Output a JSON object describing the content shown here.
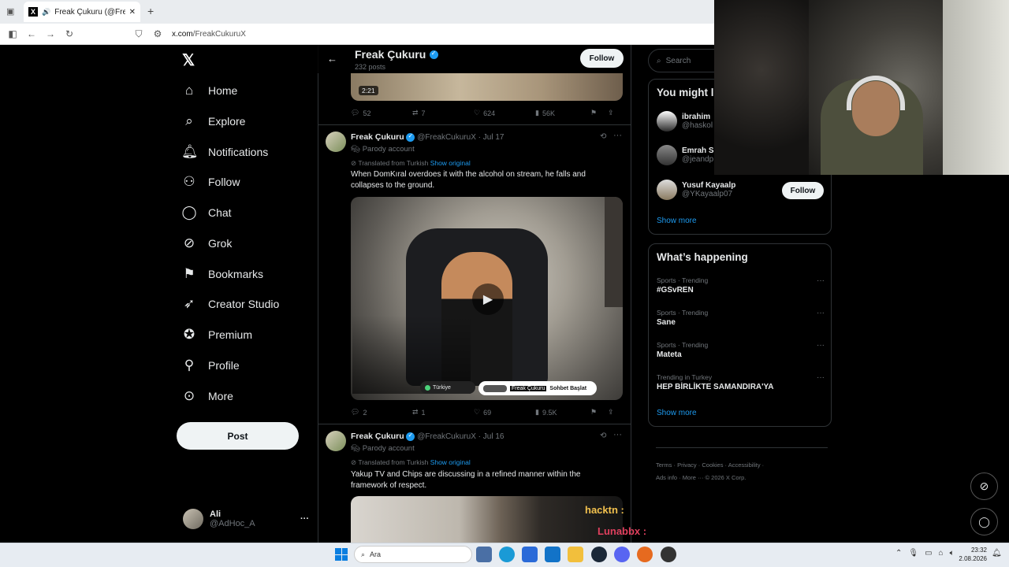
{
  "browser": {
    "tab_title": "Freak Çukuru (@FreakCuku...",
    "url_host": "x.com",
    "url_path": "/FreakCukuruX"
  },
  "nav": {
    "logo": "𝕏",
    "items": [
      {
        "label": "Home",
        "icon": "home-icon"
      },
      {
        "label": "Explore",
        "icon": "search-icon"
      },
      {
        "label": "Notifications",
        "icon": "bell-icon"
      },
      {
        "label": "Follow",
        "icon": "person-plus-icon"
      },
      {
        "label": "Chat",
        "icon": "chat-icon"
      },
      {
        "label": "Grok",
        "icon": "grok-icon"
      },
      {
        "label": "Bookmarks",
        "icon": "bookmark-icon"
      },
      {
        "label": "Creator Studio",
        "icon": "rocket-icon"
      },
      {
        "label": "Premium",
        "icon": "premium-icon"
      },
      {
        "label": "Profile",
        "icon": "person-icon"
      },
      {
        "label": "More",
        "icon": "more-circle-icon"
      }
    ],
    "post_label": "Post",
    "account_name": "Ali",
    "account_handle": "@AdHoc_A",
    "account_more": "···"
  },
  "header": {
    "name": "Freak Çukuru",
    "posts_count": "232 posts",
    "follow_label": "Follow"
  },
  "top_video": {
    "duration": "2:21",
    "replies": "52",
    "reposts": "7",
    "likes": "624",
    "views": "56K"
  },
  "tweets": [
    {
      "name": "Freak Çukuru",
      "handle": "@FreakCukuruX",
      "date": "· Jul 17",
      "badge": "Parody account",
      "translated": "Translated from Turkish",
      "show_original": "Show original",
      "text": "When DomKıral overdoes it with the alcohol on stream, he falls and collapses to the ground.",
      "replies": "2",
      "reposts": "1",
      "likes": "69",
      "views": "9.5K",
      "media": {
        "chat_country": "Türkiye",
        "chat_user": "Freak Çukuru",
        "chat_button": "Sohbet Başlat"
      }
    },
    {
      "name": "Freak Çukuru",
      "handle": "@FreakCukuruX",
      "date": "· Jul 16",
      "badge": "Parody account",
      "translated": "Translated from Turkish",
      "show_original": "Show original",
      "text": "Yakup TV and Chips are discussing in a refined manner within the framework of respect.",
      "media": {
        "overlay_1": "hacktn :",
        "overlay_2": "Lunabbx :"
      }
    }
  ],
  "sidebar": {
    "search_placeholder": "Search",
    "might_like_title": "You might l",
    "suggestions": [
      {
        "name": "ibrahim",
        "handle": "@haskol"
      },
      {
        "name": "Emrah S",
        "handle": "@jeandp"
      },
      {
        "name": "Yusuf Kayaalp",
        "handle": "@YKayaalp07",
        "follow": "Follow"
      }
    ],
    "show_more": "Show more",
    "happening_title": "What’s happening",
    "trends": [
      {
        "category": "Sports · Trending",
        "name": "#GSvREN"
      },
      {
        "category": "Sports · Trending",
        "name": "Sane"
      },
      {
        "category": "Sports · Trending",
        "name": "Mateta"
      },
      {
        "category": "Trending in Turkey",
        "name": "HEP BİRLİKTE SAMANDIRA'YA"
      }
    ],
    "trends_show_more": "Show more",
    "footer": [
      "Terms",
      "Privacy",
      "Cookies",
      "Accessibility",
      "Ads info",
      "More ···",
      "© 2026 X Corp."
    ]
  },
  "taskbar": {
    "search": "Ara",
    "time": "23:32",
    "date": "2.08.2026"
  },
  "colors": {
    "accent": "#1d9bf0",
    "background": "#000000",
    "border": "#2f3336",
    "muted": "#71767b"
  }
}
